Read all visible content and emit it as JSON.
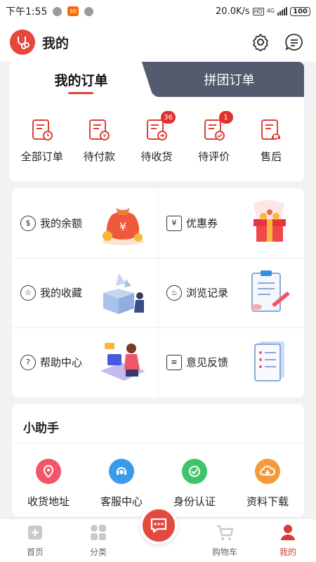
{
  "status_bar": {
    "time": "下午1:55",
    "mi_label": "MI",
    "speed": "20.0K/s",
    "hd": "HD",
    "network": "4G",
    "battery": "100"
  },
  "header": {
    "title": "我的"
  },
  "orders": {
    "tabs": [
      "我的订单",
      "拼团订单"
    ],
    "active_tab": 0,
    "items": [
      {
        "label": "全部订单",
        "icon": "order-all-icon",
        "badge": null
      },
      {
        "label": "待付款",
        "icon": "pending-payment-icon",
        "badge": null
      },
      {
        "label": "待收货",
        "icon": "pending-receipt-icon",
        "badge": "36"
      },
      {
        "label": "待评价",
        "icon": "pending-review-icon",
        "badge": "1"
      },
      {
        "label": "售后",
        "icon": "after-sales-icon",
        "badge": null
      }
    ]
  },
  "grid": [
    {
      "label": "我的余额",
      "icon": "wallet-icon",
      "glyph": "$"
    },
    {
      "label": "优惠券",
      "icon": "coupon-icon",
      "glyph": "¥"
    },
    {
      "label": "我的收藏",
      "icon": "star-icon",
      "glyph": "☆"
    },
    {
      "label": "浏览记录",
      "icon": "footprint-icon",
      "glyph": "♨"
    },
    {
      "label": "帮助中心",
      "icon": "help-icon",
      "glyph": "?"
    },
    {
      "label": "意见反馈",
      "icon": "feedback-icon",
      "glyph": "≡"
    }
  ],
  "helper": {
    "title": "小助手",
    "items": [
      {
        "label": "收货地址",
        "icon": "location-icon",
        "color": "#f0556a"
      },
      {
        "label": "客服中心",
        "icon": "customer-service-icon",
        "color": "#3c9be8"
      },
      {
        "label": "身份认证",
        "icon": "verified-icon",
        "color": "#3fc46b"
      },
      {
        "label": "资料下载",
        "icon": "cloud-download-icon",
        "color": "#f39a3a"
      }
    ]
  },
  "nav": {
    "items": [
      "首页",
      "分类",
      "购物车",
      "我的"
    ],
    "active": 3
  },
  "colors": {
    "accent": "#e0403a",
    "tab_dark": "#555b6e"
  }
}
